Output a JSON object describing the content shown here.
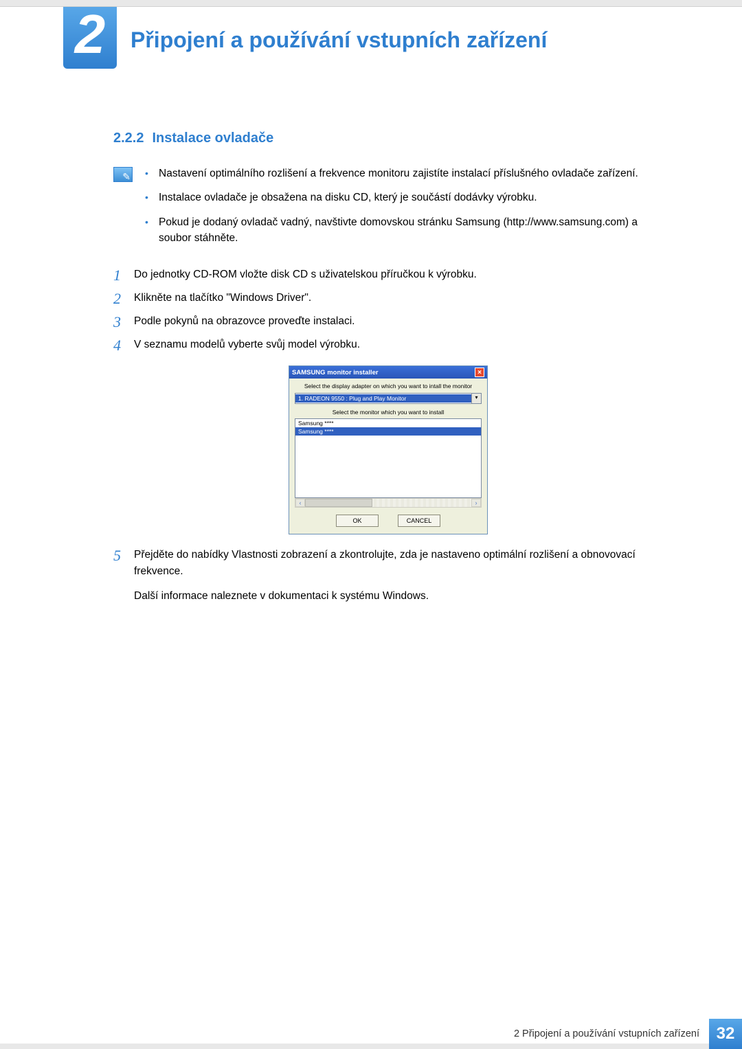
{
  "header": {
    "chapter_number": "2",
    "chapter_title": "Připojení a používání vstupních zařízení"
  },
  "section": {
    "number": "2.2.2",
    "title": "Instalace ovladače"
  },
  "notes": [
    "Nastavení optimálního rozlišení a frekvence monitoru zajistíte instalací příslušného ovladače zařízení.",
    "Instalace ovladače je obsažena na disku CD, který je součástí dodávky výrobku.",
    "Pokud je dodaný ovladač vadný, navštivte domovskou stránku Samsung (http://www.samsung.com) a soubor stáhněte."
  ],
  "steps": [
    "Do jednotky CD-ROM vložte disk CD s uživatelskou příručkou k výrobku.",
    "Klikněte na tlačítko \"Windows Driver\".",
    "Podle pokynů na obrazovce proveďte instalaci.",
    "V seznamu modelů vyberte svůj model výrobku.",
    "Přejděte do nabídky Vlastnosti zobrazení a zkontrolujte, zda je nastaveno optimální rozlišení a obnovovací frekvence."
  ],
  "step5_extra": "Další informace naleznete v dokumentaci k systému Windows.",
  "dialog": {
    "title": "SAMSUNG monitor installer",
    "close_glyph": "×",
    "label_adapter": "Select the display adapter on which you want to intall the monitor",
    "adapter_selected": "1. RADEON 9550 : Plug and Play Monitor",
    "dropdown_glyph": "▾",
    "label_monitor": "Select the monitor which you want to install",
    "list_items": [
      "Samsung ****",
      "Samsung ****"
    ],
    "scroll_left": "‹",
    "scroll_right": "›",
    "ok_label": "OK",
    "cancel_label": "CANCEL"
  },
  "footer": {
    "label": "2 Připojení a používání vstupních zařízení",
    "page": "32"
  }
}
